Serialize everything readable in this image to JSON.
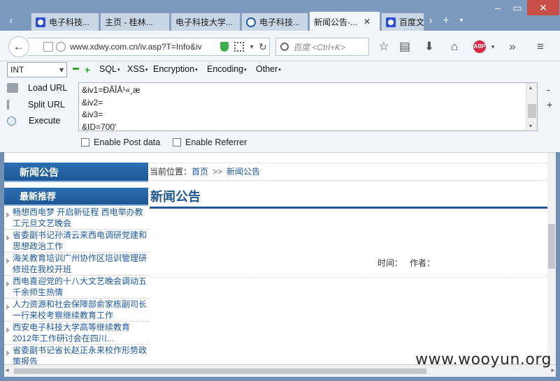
{
  "tabs": [
    {
      "label": "电子科技...",
      "icon": "baidu-paw-icon"
    },
    {
      "label": "主页 - 桂林...",
      "icon": ""
    },
    {
      "label": "电子科技大学...",
      "icon": ""
    },
    {
      "label": "电子科技...",
      "icon": "globe-icon"
    },
    {
      "label": "新闻公告-...",
      "icon": "",
      "active": true
    },
    {
      "label": "百度文",
      "icon": "baidu-paw-icon"
    }
  ],
  "navbar": {
    "url": "www.xdwy.com.cn/iv.asp?T=Info&iv",
    "search_placeholder": "百度 <Ctrl+K>"
  },
  "hackbar": {
    "select_value": "INT",
    "menus": [
      "SQL",
      "XSS",
      "Encryption",
      "Encoding",
      "Other"
    ],
    "load_url": "Load URL",
    "split_url": "Split URL",
    "execute": "Execute",
    "textarea_lines": [
      "&iv1=ÐÂÎÅ¹«¸æ",
      "&iv2=",
      "&iv3=",
      "&ID=700'"
    ],
    "enable_post": "Enable Post data",
    "enable_referrer": "Enable Referrer"
  },
  "sidebar": {
    "header": "新闻公告",
    "subheader": "最新推荐",
    "items": [
      "畅想西电梦 开启新征程 西电举办教工元旦文艺晚会",
      "省委副书记孙清云来西电调研党建和思想政治工作",
      "海关教育培训广州协作区培训管理研修班在我校开班",
      "西电喜迎党的十八大文艺晚会调动五千余师生热情",
      "人力资源和社会保障部俞家栋副司长一行来校考察继续教育工作",
      "西安电子科技大学高等继续教育2012年工作研讨会在四川...",
      "省委副书记省长赵正永来校作形势政策报告"
    ]
  },
  "main": {
    "breadcrumb_prefix": "当前位置：",
    "crumbs": [
      "首页",
      "新闻公告"
    ],
    "crumb_sep": ">>",
    "title": "新闻公告",
    "meta": "时间：   作者："
  },
  "watermark": "www.wooyun.org"
}
